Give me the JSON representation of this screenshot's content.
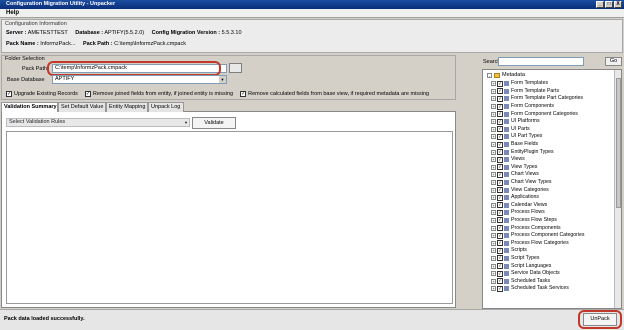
{
  "window": {
    "title": "Configuration Migration Utility - Unpacker",
    "controls": [
      "_",
      "□",
      "X"
    ]
  },
  "menu": {
    "help": "Help"
  },
  "info": {
    "legend": "Configuration Information",
    "server_label": "Server :",
    "server_value": "AMETESTTEST",
    "database_label": "Database :",
    "database_value": "APTIFY(5.5.2.0)",
    "config_version_label": "Config Migration Version :",
    "config_version_value": "5.5.3.10",
    "pack_name_label": "Pack Name :",
    "pack_name_value": "InformzPack...",
    "pack_path_label": "Pack Path :",
    "pack_path_value": "C:\\temp\\InformzPack.cmpack"
  },
  "folder": {
    "legend": "Folder Selection",
    "pack_path_label": "Pack Path",
    "pack_path_value": "C:\\temp\\InformzPack.cmpack",
    "base_db_label": "Base Database",
    "base_db_value": "APTIFY",
    "checkboxes": [
      {
        "label": "Upgrade Existing Records",
        "checked": true
      },
      {
        "label": "Remove joined fields from entity, if joined entity is missing",
        "checked": true
      },
      {
        "label": "Remove calculated fields from base view, if required metadata are missing",
        "checked": true
      }
    ]
  },
  "tabs": [
    "Validation Summary",
    "Set Default Value",
    "Entity Mapping",
    "Unpack Log"
  ],
  "validation": {
    "rules_placeholder": "Select Validation Rules",
    "validate_label": "Validate"
  },
  "right": {
    "search_label": "Search",
    "go_label": "Go",
    "root": "Metadata",
    "items": [
      "Form Templates",
      "Form Template Parts",
      "Form Template Part Categories",
      "Form Components",
      "Form Component Categories",
      "UI Platforms",
      "UI Parts",
      "UI Part Types",
      "Base Fields",
      "EntityPlugin Types",
      "Views",
      "View Types",
      "Chart Views",
      "Chart View Types",
      "View Categories",
      "Applications",
      "Calendar Views",
      "Process Flows",
      "Process Flow Steps",
      "Process Components",
      "Process Component Categories",
      "Process Flow Categories",
      "Scripts",
      "Script Types",
      "Script Languages",
      "Service Data Objects",
      "Scheduled Tasks",
      "Scheduled Task Services"
    ]
  },
  "status": {
    "message": "Pack data loaded successfully.",
    "unpack_label": "UnPack"
  },
  "colors": {
    "highlight": "#c0392b",
    "titlebar": "#1c4ea1"
  }
}
